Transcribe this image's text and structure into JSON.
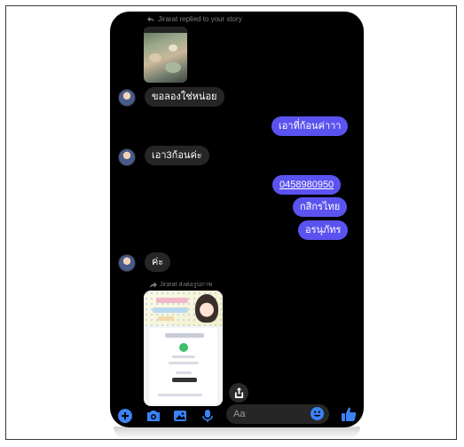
{
  "thread": {
    "reply_note": "Jirarat replied to your story",
    "share_note": "Jirarat ส่งต่อรูปภาพ",
    "messages": [
      {
        "from": "them",
        "text": "ขอลองใช่หน่อย"
      },
      {
        "from": "me",
        "text": "เอาที่ก้อนค่าาา"
      },
      {
        "from": "them",
        "text": "เอา3ก้อนค่ะ"
      },
      {
        "from": "me",
        "text": "0458980950",
        "link": true
      },
      {
        "from": "me",
        "text": "กสิกรไทย"
      },
      {
        "from": "me",
        "text": "อรนุภัทร"
      },
      {
        "from": "them",
        "text": "ค่ะ"
      }
    ]
  },
  "slip": {
    "bank": "Bangkok Bank",
    "status": "โอนเงินสำเร็จ",
    "amount": "180.00"
  },
  "composer": {
    "placeholder": "Aa"
  },
  "colors": {
    "background": "#000000",
    "outgoing_bubble": "#5b53f0",
    "incoming_bubble": "#262626",
    "accent": "#3b82f6"
  },
  "icons": [
    "reply-arrow-icon",
    "share-arrow-icon",
    "share-icon",
    "plus-icon",
    "camera-icon",
    "image-icon",
    "mic-icon",
    "emoji-icon",
    "thumbs-up-icon"
  ]
}
